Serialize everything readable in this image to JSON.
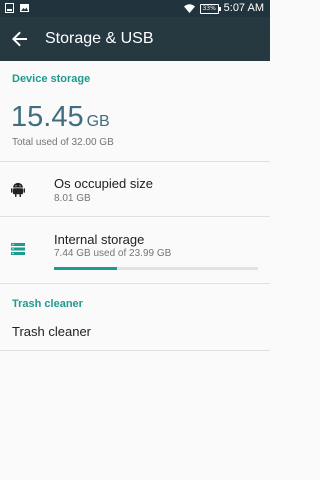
{
  "status_bar": {
    "time": "5:07 AM",
    "battery_label": "33%",
    "icons": [
      "notification-icon",
      "image-icon",
      "wifi-icon",
      "battery-icon"
    ]
  },
  "app_bar": {
    "title": "Storage & USB"
  },
  "device_storage": {
    "header": "Device storage",
    "used_value": "15.45",
    "used_unit": "GB",
    "total_line": "Total used of 32.00 GB"
  },
  "items": [
    {
      "icon": "android-icon",
      "title": "Os occupied size",
      "subtitle": "8.01 GB"
    },
    {
      "icon": "storage-list-icon",
      "title": "Internal storage",
      "subtitle": "7.44 GB used of 23.99 GB",
      "progress": 0.31
    }
  ],
  "trash": {
    "header": "Trash cleaner",
    "item": "Trash cleaner"
  },
  "colors": {
    "accent": "#1e9b8f",
    "status_bar": "#21343d",
    "app_bar": "#263840",
    "big_number": "#3f6e80"
  }
}
